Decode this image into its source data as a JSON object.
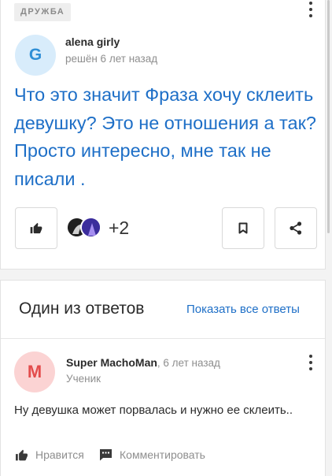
{
  "question": {
    "category": "ДРУЖБА",
    "author": "alena girly",
    "avatar_letter": "G",
    "status": "решён 6 лет назад",
    "text": "Что это значит Фраза хочу склеить девушку? Это не отношения а так? Просто интересно, мне так не писали .",
    "likes_extra": "+2"
  },
  "answers": {
    "title": "Один из ответов",
    "show_all": "Показать все ответы",
    "top": {
      "avatar_letter": "M",
      "author": "Super MachoMan",
      "time": ", 6 лет назад",
      "rank": "Ученик",
      "text": "Ну девушка может порвалась и нужно ее склеить..",
      "like_label": "Нравится",
      "comment_label": "Комментировать"
    }
  },
  "icons": [
    "thumb-up-icon",
    "bookmark-icon",
    "share-icon",
    "more-vert-icon",
    "comment-icon"
  ],
  "colors": {
    "link": "#1e6fc7",
    "muted": "#8e8e8e",
    "avatar_g_bg": "#d8ecfb",
    "avatar_m_bg": "#fbd3d3"
  }
}
